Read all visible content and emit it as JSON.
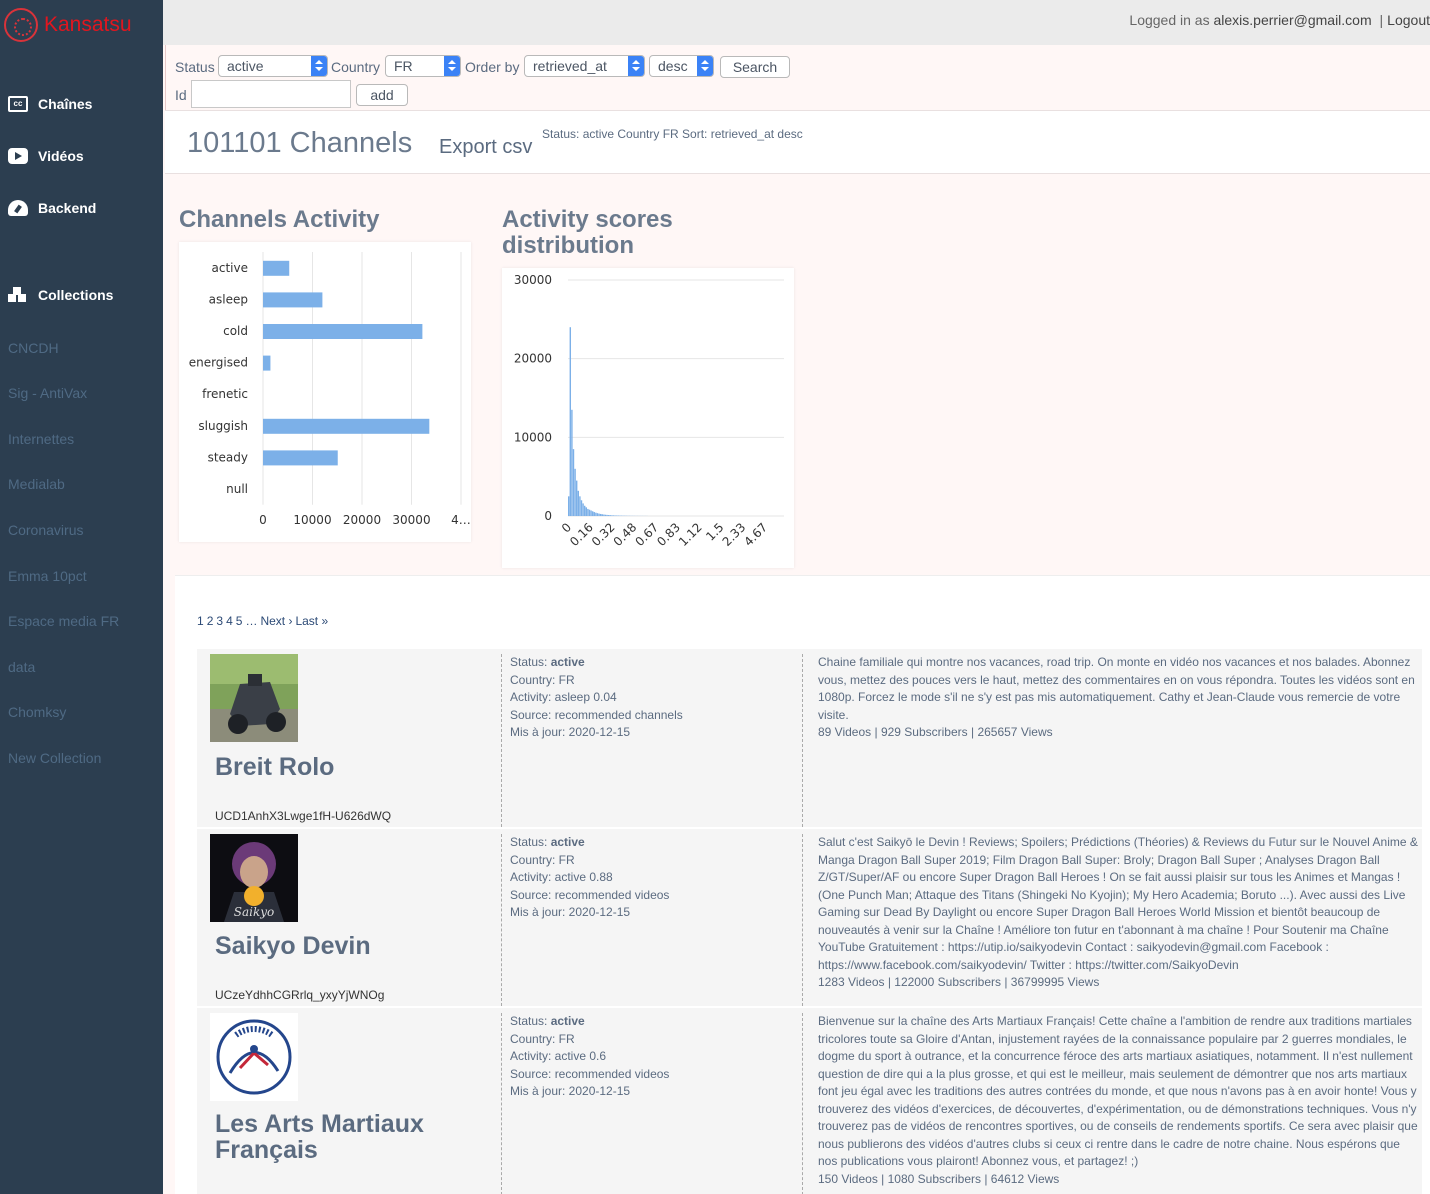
{
  "brand": {
    "name": "Kansatsu"
  },
  "sidebar": {
    "main": [
      {
        "label": "Chaînes",
        "icon": "closed-captions-icon"
      },
      {
        "label": "Vidéos",
        "icon": "video-icon"
      },
      {
        "label": "Backend",
        "icon": "dashboard-icon"
      }
    ],
    "collections_label": "Collections",
    "collections": [
      "CNCDH",
      "Sig - AntiVax",
      "Internettes",
      "Medialab",
      "Coronavirus",
      "Emma 10pct",
      "Espace media FR",
      "data",
      "Chomksy",
      "New Collection"
    ]
  },
  "topbar": {
    "prefix": "Logged in as",
    "user": "alexis.perrier@gmail.com",
    "separator": "|",
    "logout": "Logout"
  },
  "filters": {
    "status_label": "Status",
    "status_value": "active",
    "country_label": "Country",
    "country_value": "FR",
    "order_label": "Order by",
    "order_value": "retrieved_at",
    "direction_value": "desc",
    "search_label": "Search",
    "id_label": "Id",
    "id_value": "",
    "add_label": "add"
  },
  "header": {
    "count": "101101 Channels",
    "export": "Export csv",
    "status_line": "Status: active Country FR Sort: retrieved_at desc"
  },
  "charts": {
    "activity_title": "Channels Activity",
    "distribution_title": "Activity scores distribution"
  },
  "chart_data": [
    {
      "type": "bar",
      "orientation": "horizontal",
      "title": "Channels Activity",
      "categories": [
        "active",
        "asleep",
        "cold",
        "energised",
        "frenetic",
        "sluggish",
        "steady",
        "null"
      ],
      "values": [
        5300,
        12000,
        32200,
        1500,
        0,
        33600,
        15100,
        0
      ],
      "xlim": [
        0,
        40000
      ],
      "x_ticks": [
        "0",
        "10000",
        "20000",
        "30000",
        "4…"
      ],
      "color": "#7cb0e8",
      "grid": true
    },
    {
      "type": "bar",
      "title": "Activity scores distribution",
      "x_tick_labels": [
        "0",
        "0.16",
        "0.32",
        "0.48",
        "0.67",
        "0.83",
        "1.12",
        "1.5",
        "2.33",
        "4.67"
      ],
      "values": [
        2500,
        24000,
        13500,
        8500,
        6000,
        4500,
        3200,
        2500,
        2000,
        1600,
        1300,
        1100,
        900,
        800,
        700,
        600,
        500,
        420,
        360,
        300,
        260,
        220,
        190,
        160,
        140,
        120,
        100,
        90,
        80,
        70,
        60,
        55,
        50,
        45,
        40,
        35,
        30,
        28,
        25,
        22,
        20,
        18,
        16,
        15,
        14,
        13,
        12,
        11,
        10,
        9
      ],
      "ylim": [
        0,
        30000
      ],
      "y_ticks": [
        "0",
        "10000",
        "20000",
        "30000"
      ],
      "color": "#7cb0e8",
      "grid": true
    }
  ],
  "pager": {
    "pages": [
      "1",
      "2",
      "3",
      "4",
      "5"
    ],
    "ellipsis": "…",
    "next": "Next ›",
    "last": "Last »"
  },
  "channels": [
    {
      "title": "Breit Rolo",
      "id": "UCD1AnhX3Lwge1fH-U626dWQ",
      "status_label": "Status:",
      "status": "active",
      "country": "Country: FR",
      "activity": "Activity: asleep 0.04",
      "source": "Source: recommended channels",
      "updated": "Mis à jour: 2020-12-15",
      "description": "Chaine familiale qui montre nos vacances, road trip. On monte en vidéo nos vacances et nos balades. Abonnez vous, mettez des pouces vers le haut, mettez des commentaires en on vous répondra. Toutes les vidéos sont en 1080p. Forcez le mode s'il ne s'y est pas mis automatiquement. Cathy et Jean-Claude vous remercie de votre visite.",
      "stats": "89 Videos | 929 Subscribers | 265657 Views"
    },
    {
      "title": "Saikyo Devin",
      "id": "UCzeYdhhCGRrlq_yxyYjWNOg",
      "status_label": "Status:",
      "status": "active",
      "country": "Country: FR",
      "activity": "Activity: active 0.88",
      "source": "Source: recommended videos",
      "updated": "Mis à jour: 2020-12-15",
      "description": "Salut c'est Saikyō le Devin ! Reviews; Spoilers; Prédictions (Théories) & Reviews du Futur sur le Nouvel Anime & Manga Dragon Ball Super 2019; Film Dragon Ball Super: Broly; Dragon Ball Super ; Analyses Dragon Ball Z/GT/Super/AF ou encore Super Dragon Ball Heroes ! On se fait aussi plaisir sur tous les Animes et Mangas ! (One Punch Man; Attaque des Titans (Shingeki No Kyojin); My Hero Academia; Boruto ...). Avec aussi des Live Gaming sur Dead By Daylight ou encore Super Dragon Ball Heroes World Mission et bientôt beaucoup de nouveautés à venir sur la Chaîne ! Améliore ton futur en t'abonnant à ma chaîne ! Pour Soutenir ma Chaîne YouTube Gratuitement : https://utip.io/saikyodevin Contact : saikyodevin@gmail.com Facebook : https://www.facebook.com/saikyodevin/ Twitter : https://twitter.com/SaikyoDevin",
      "stats": "1283 Videos | 122000 Subscribers | 36799995 Views"
    },
    {
      "title": "Les Arts Martiaux Français",
      "id": "",
      "status_label": "Status:",
      "status": "active",
      "country": "Country: FR",
      "activity": "Activity: active 0.6",
      "source": "Source: recommended videos",
      "updated": "Mis à jour: 2020-12-15",
      "description": "Bienvenue sur la chaîne des Arts Martiaux Français! Cette chaîne a l'ambition de rendre aux traditions martiales tricolores toute sa Gloire d'Antan, injustement rayées de la connaissance populaire par 2 guerres mondiales, le dogme du sport à outrance, et la concurrence féroce des arts martiaux asiatiques, notamment. Il n'est nullement question de dire qui a la plus grosse, et qui est le meilleur, mais seulement de démontrer que nos arts martiaux font jeu égal avec les traditions des autres contrées du monde, et que nous n'avons pas à en avoir honte! Vous y trouverez des vidéos d'exercices, de découvertes, d'expérimentation, ou de démonstrations techniques. Vous n'y trouverez pas de vidéos de rencontres sportives, ou de conseils de rendements sportifs. Ce sera avec plaisir que nous publierons des vidéos d'autres clubs si ceux ci rentre dans le cadre de notre chaine. Nous espérons que nos publications vous plairont! Abonnez vous, et partagez! ;)",
      "stats": "150 Videos | 1080 Subscribers | 64612 Views"
    }
  ]
}
